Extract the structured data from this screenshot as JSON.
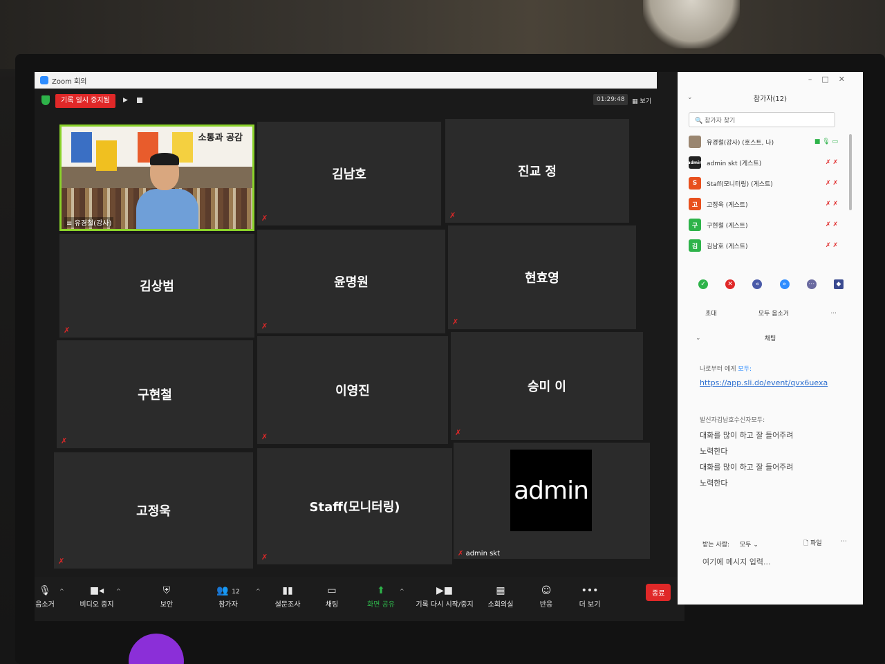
{
  "window": {
    "title": "Zoom 회의"
  },
  "topbar": {
    "recording_label": "기록 일시 중지됨",
    "timer": "01:29:48",
    "view_label": "보기"
  },
  "tiles": [
    {
      "name": "유경철(강사)",
      "host_label": "유경철(강사)",
      "poster_title": "소통과 공감"
    },
    {
      "name": "김남호"
    },
    {
      "name": "진교 정"
    },
    {
      "name": "김상범"
    },
    {
      "name": "윤명원"
    },
    {
      "name": "현효영"
    },
    {
      "name": "구현철"
    },
    {
      "name": "이영진"
    },
    {
      "name": "승미 이"
    },
    {
      "name": "고정욱"
    },
    {
      "name": "Staff(모니터링)"
    },
    {
      "name": "admin skt",
      "avatar_text": "admin"
    }
  ],
  "toolbar": {
    "mute": "음소거",
    "video_stop": "비디오 중지",
    "security": "보안",
    "participants": "참가자",
    "participants_count": "12",
    "polls": "설문조사",
    "chat": "채팅",
    "share_screen": "화면 공유",
    "record": "기록 다시 시작/중지",
    "breakout": "소회의실",
    "reactions": "반응",
    "more": "더 보기",
    "end": "종료"
  },
  "panel": {
    "title": "참가자(12)",
    "search_placeholder": "참가자 찾기",
    "participants": [
      {
        "name": "유경철(강사) (호스트, 나)",
        "initial": "",
        "color": "#9a8670"
      },
      {
        "name": "admin skt (게스트)",
        "initial": "admin",
        "color": "#222222"
      },
      {
        "name": "Staff(모니터링) (게스트)",
        "initial": "S",
        "color": "#e8501e"
      },
      {
        "name": "고정욱 (게스트)",
        "initial": "고",
        "color": "#e8501e"
      },
      {
        "name": "구현철 (게스트)",
        "initial": "구",
        "color": "#2eb34a"
      },
      {
        "name": "김남호 (게스트)",
        "initial": "김",
        "color": "#2eb34a"
      }
    ],
    "invite": "초대",
    "mute_all": "모두 음소거",
    "more": "...",
    "chat_title": "채팅",
    "chat": {
      "msg1_meta_prefix": "나로부터 에게",
      "msg1_meta_to": "모두:",
      "msg1_link": "https://app.sli.do/event/qvx6uexa",
      "msg2_meta": "발신자김남호수신자모두:",
      "msg2_line1": "대화를 많이 하고 잘 들어주려",
      "msg2_line2": "노력한다",
      "msg2_line3": "대화를 많이 하고 잘 들어주려",
      "msg2_line4": "노력한다"
    },
    "send_to_label": "받는 사람:",
    "send_to_value": "모두",
    "file_label": "파일",
    "input_placeholder": "여기에 메시지 입력..."
  },
  "colors": {
    "accent_green": "#2eb34a",
    "end_red": "#e02828",
    "active_border": "#8bd32a"
  }
}
